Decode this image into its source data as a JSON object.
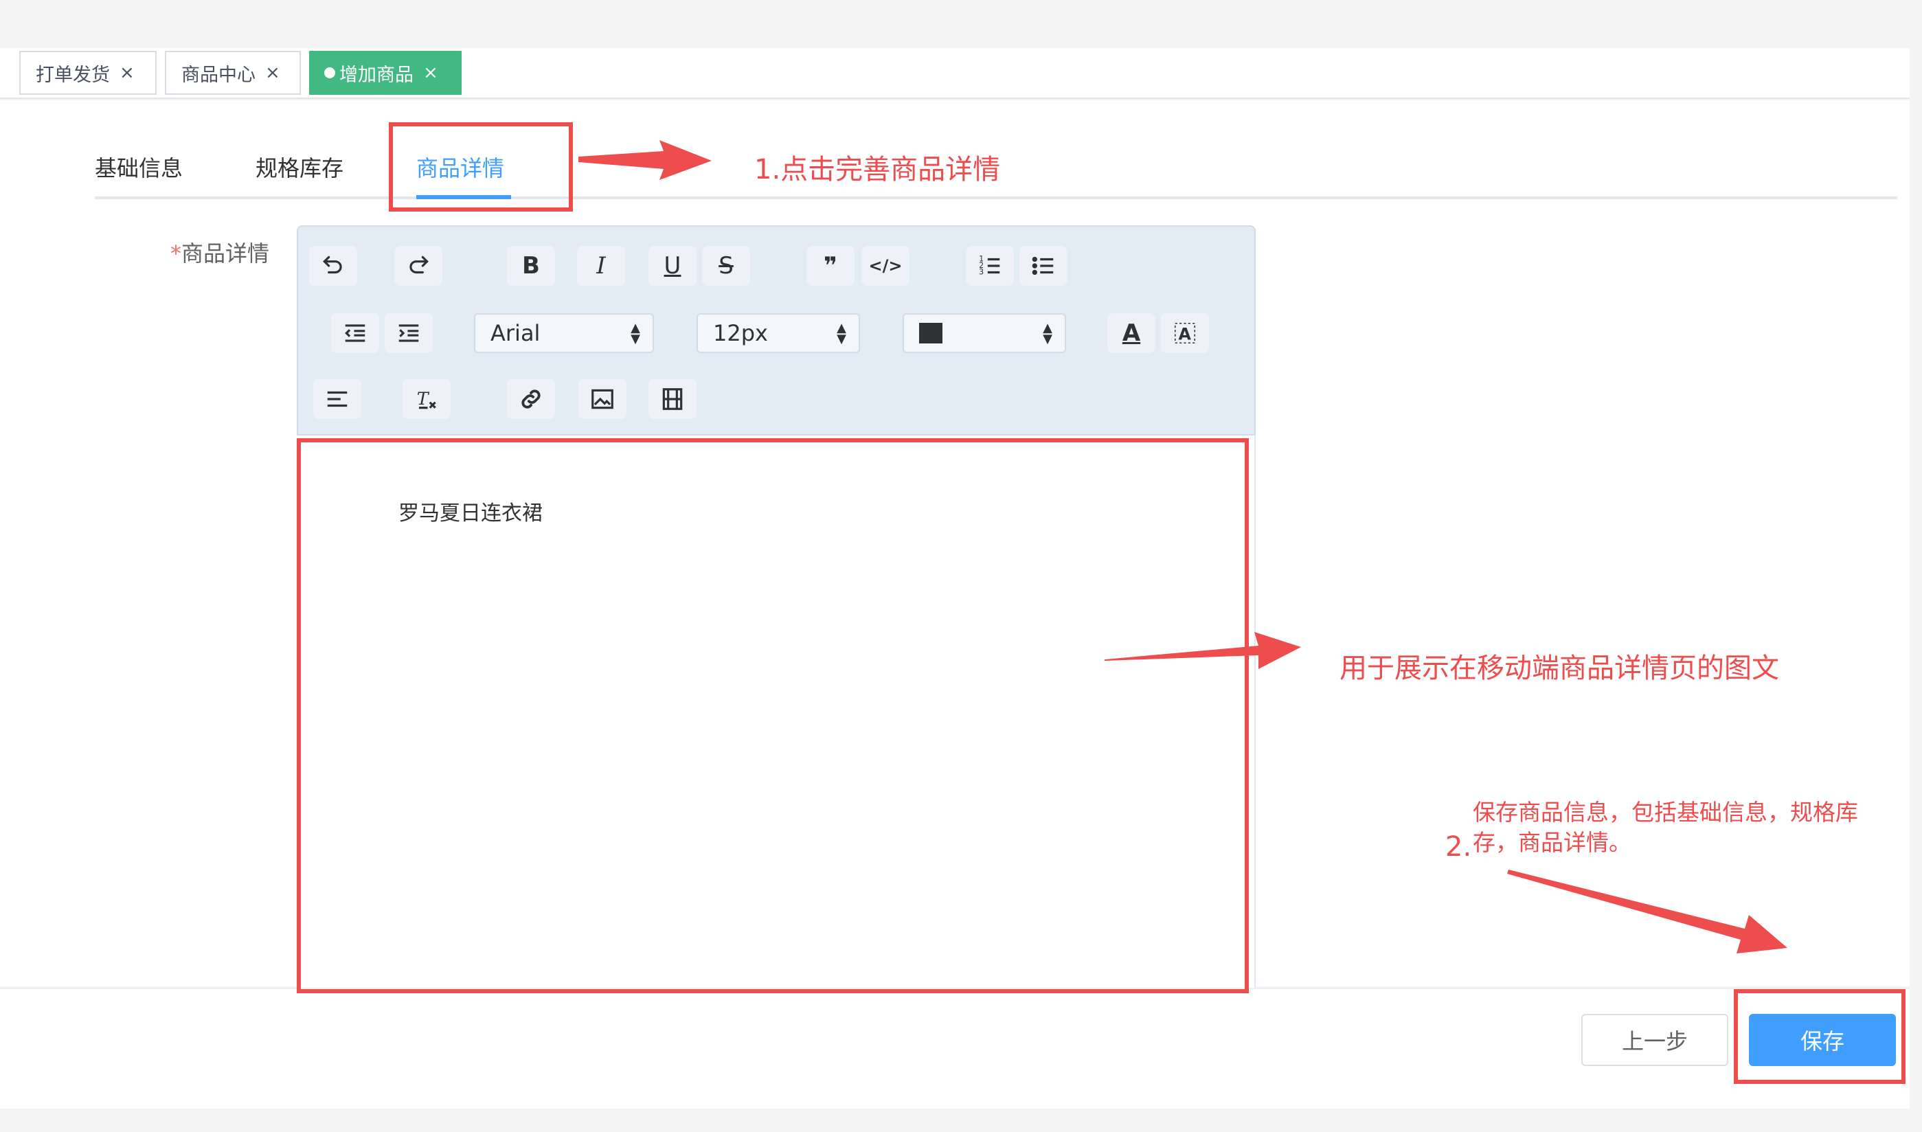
{
  "tags": [
    {
      "label": "打单发货",
      "active": false
    },
    {
      "label": "商品中心",
      "active": false
    },
    {
      "label": "增加商品",
      "active": true
    }
  ],
  "tag_close": "×",
  "tabs": [
    "基础信息",
    "规格库存",
    "商品详情"
  ],
  "form": {
    "required_mark": "*",
    "label": "商品详情"
  },
  "toolbar": {
    "font_family": "Arial",
    "font_size": "12px",
    "buttons": [
      "undo",
      "redo",
      "bold",
      "italic",
      "underline",
      "strikethrough",
      "blockquote",
      "code",
      "ordered-list",
      "bullet-list",
      "outdent",
      "indent",
      "font-color",
      "background-color",
      "align",
      "clear-format",
      "link",
      "image",
      "video"
    ],
    "bold": "B",
    "italic": "I",
    "underline": "U",
    "strike": "S",
    "quote": "❞",
    "code": "</>",
    "font_color": "A"
  },
  "editor": {
    "content": "罗马夏日连衣裙"
  },
  "footer": {
    "prev_label": "上一步",
    "save_label": "保存"
  },
  "annotations": {
    "step1": "1.点击完善商品详情",
    "editor_note": "用于展示在移动端商品详情页的图文",
    "step2_number": "2.",
    "step2_line1": "保存商品信息，包括基础信息，规格库",
    "step2_line2": "存，商品详情。"
  },
  "colors": {
    "accent": "#409eff",
    "tag_active": "#42b983",
    "annotation": "#ee4d4d"
  }
}
